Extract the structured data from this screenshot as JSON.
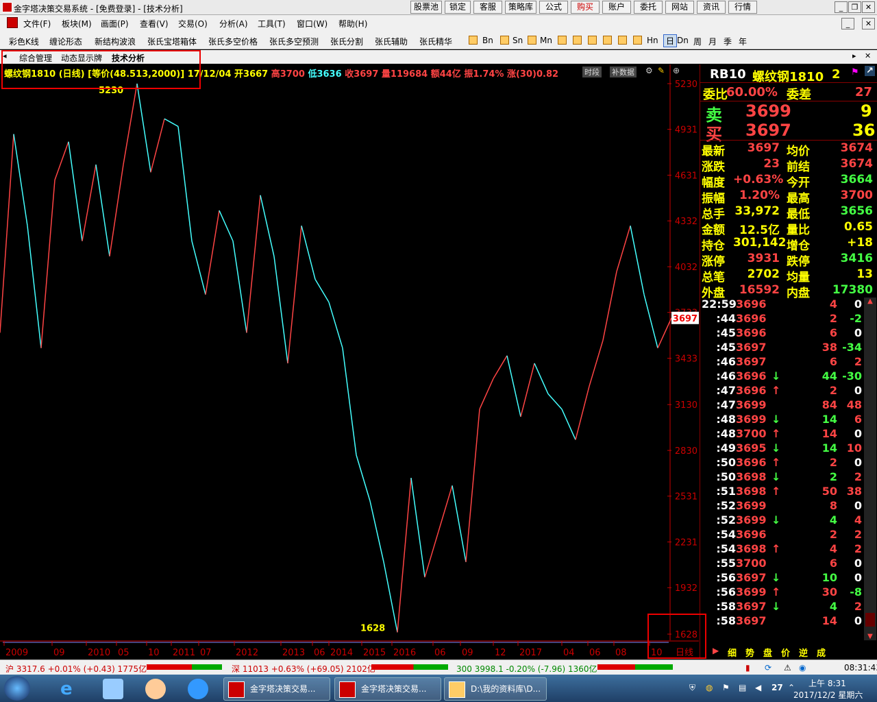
{
  "window": {
    "title": "金字塔决策交易系统 - [免费登录] - [技术分析]"
  },
  "top_buttons": [
    "股票池",
    "锁定",
    "客服",
    "策略库",
    "公式",
    "购买",
    "账户",
    "委托",
    "网站",
    "资讯",
    "行情"
  ],
  "menu": [
    "文件(F)",
    "板块(M)",
    "画面(P)",
    "查看(V)",
    "交易(O)",
    "分析(A)",
    "工具(T)",
    "窗口(W)",
    "帮助(H)"
  ],
  "toolbar": {
    "items": [
      "彩色K线",
      "缠论形态",
      "新结构波浪",
      "张氏宝塔箱体",
      "张氏多空价格",
      "张氏多空预测",
      "张氏分割",
      "张氏辅助",
      "张氏精华"
    ],
    "periods": [
      "Bn",
      "Sn",
      "Mn",
      "Hn",
      "日",
      "Dn",
      "周",
      "月",
      "季",
      "年"
    ],
    "period_icons": [
      "1'",
      "5'",
      "10'",
      "15'",
      "30'",
      "60'"
    ]
  },
  "tabs": [
    "综合管理",
    "动态显示牌",
    "技术分析"
  ],
  "chart_header": {
    "name": "螺纹钢1810 (日线)",
    "param": "[等价(48.513,2000)]",
    "date": "17/12/04",
    "open": "开3667",
    "high": "高3700",
    "low": "低3636",
    "close": "收3697",
    "vol": "量119684",
    "amount": "额44亿",
    "amp": "振1.74%",
    "chg": "涨(30)0.82",
    "btn_period": "时段",
    "btn_supp": "补数据"
  },
  "chart_data": {
    "type": "line",
    "title": "螺纹钢1810 (日线)",
    "y_ticks": [
      5230,
      4931,
      4631,
      4332,
      4032,
      3733,
      3433,
      3130,
      2830,
      2531,
      2231,
      1932,
      1628
    ],
    "ylim": [
      1628,
      5230
    ],
    "x_ticks": [
      "2009",
      "09",
      "2010",
      "05",
      "10",
      "2011",
      "07",
      "2012",
      "2013",
      "06",
      "2014",
      "2015",
      "2016",
      "06",
      "09",
      "12",
      "2017",
      "04",
      "06",
      "08",
      "10"
    ],
    "last_price": "3697",
    "max_label": "5230",
    "min_label": "1628",
    "x": [
      0,
      20,
      40,
      60,
      80,
      100,
      120,
      140,
      160,
      180,
      200,
      220,
      240,
      260,
      280,
      300,
      320,
      340,
      360,
      380,
      400,
      420,
      440,
      460,
      480,
      500,
      520,
      540,
      560,
      580,
      600,
      620,
      640,
      660,
      680,
      700,
      720,
      740,
      760,
      780,
      800,
      820,
      840,
      860,
      880,
      900,
      920,
      940,
      960,
      980
    ],
    "values": [
      3600,
      4900,
      4300,
      3500,
      4600,
      4850,
      4200,
      4700,
      4100,
      4700,
      5230,
      4650,
      5000,
      4950,
      4200,
      3850,
      4400,
      4200,
      3600,
      4500,
      4100,
      3400,
      4300,
      3950,
      3800,
      3500,
      2800,
      2500,
      2100,
      1640,
      2650,
      2000,
      2300,
      2600,
      2100,
      3100,
      3300,
      3450,
      3050,
      3400,
      3200,
      3100,
      2900,
      3250,
      3550,
      4000,
      4300,
      3850,
      3500,
      3697
    ],
    "period_label": "日线"
  },
  "quote_panel": {
    "code": "RB10",
    "name": "螺纹钢1810",
    "num": "2",
    "ratio_label": "委比",
    "ratio": "60.00%",
    "diff_label": "委差",
    "diff": "27",
    "sell_label": "卖",
    "sell_price": "3699",
    "sell_vol": "9",
    "buy_label": "买",
    "buy_price": "3697",
    "buy_vol": "36",
    "stats": [
      [
        "最新",
        "3697",
        "均价",
        "3674"
      ],
      [
        "涨跌",
        "23",
        "前结",
        "3674"
      ],
      [
        "幅度",
        "+0.63%",
        "今开",
        "3664"
      ],
      [
        "振幅",
        "1.20%",
        "最高",
        "3700"
      ],
      [
        "总手",
        "33,972",
        "最低",
        "3656"
      ],
      [
        "金额",
        "12.5亿",
        "量比",
        "0.65"
      ],
      [
        "持仓",
        "301,142",
        "增仓",
        "+18"
      ],
      [
        "涨停",
        "3931",
        "跌停",
        "3416"
      ],
      [
        "总笔",
        "2702",
        "均量",
        "13"
      ],
      [
        "外盘",
        "16592",
        "内盘",
        "17380"
      ]
    ],
    "ticks": [
      [
        "22:59",
        "3696",
        "",
        "4",
        "0"
      ],
      [
        ":44",
        "3696",
        "",
        "2",
        "-2"
      ],
      [
        ":45",
        "3696",
        "",
        "6",
        "0"
      ],
      [
        ":45",
        "3697",
        "",
        "38",
        "-34"
      ],
      [
        ":46",
        "3697",
        "",
        "6",
        "2"
      ],
      [
        ":46",
        "3696",
        "↓",
        "44",
        "-30"
      ],
      [
        ":47",
        "3696",
        "↑",
        "2",
        "0"
      ],
      [
        ":47",
        "3699",
        "",
        "84",
        "48"
      ],
      [
        ":48",
        "3699",
        "↓",
        "14",
        "6"
      ],
      [
        ":48",
        "3700",
        "↑",
        "14",
        "0"
      ],
      [
        ":49",
        "3695",
        "↓",
        "14",
        "10"
      ],
      [
        ":50",
        "3696",
        "↑",
        "2",
        "0"
      ],
      [
        ":50",
        "3698",
        "↓",
        "2",
        "2"
      ],
      [
        ":51",
        "3698",
        "↑",
        "50",
        "38"
      ],
      [
        ":52",
        "3699",
        "",
        "8",
        "0"
      ],
      [
        ":52",
        "3699",
        "↓",
        "4",
        "4"
      ],
      [
        ":54",
        "3696",
        "",
        "2",
        "2"
      ],
      [
        ":54",
        "3698",
        "↑",
        "4",
        "2"
      ],
      [
        ":55",
        "3700",
        "",
        "6",
        "0"
      ],
      [
        ":56",
        "3697",
        "↓",
        "10",
        "0"
      ],
      [
        ":56",
        "3699",
        "↑",
        "30",
        "-8"
      ],
      [
        ":58",
        "3697",
        "↓",
        "4",
        "2"
      ],
      [
        ":58",
        "3697",
        "",
        "14",
        "0"
      ]
    ],
    "bottom_tabs": [
      "细",
      "势",
      "盘",
      "价",
      "逆",
      "成"
    ]
  },
  "status": {
    "sh": "沪 3317.6 +0.01% (+0.43) 1775亿",
    "sz": "深 11013 +0.63% (+69.05) 2102亿",
    "hs300": "300 3998.1 -0.20% (-7.96) 1360亿",
    "time": "08:31:43"
  },
  "taskbar": {
    "tasks": [
      "金字塔决策交易...",
      "金字塔决策交易...",
      "D:\\我的资料库\\D..."
    ],
    "clock_time": "上午 8:31",
    "clock_date": "2017/12/2 星期六",
    "day": "27"
  },
  "colors": {
    "up": "#ff4444",
    "down": "#44ffff",
    "yellow": "#ffff00",
    "accent": "#cc0000"
  }
}
